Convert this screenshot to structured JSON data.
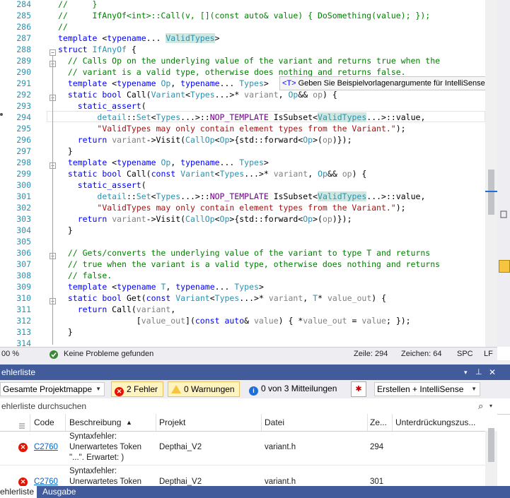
{
  "editor": {
    "lines": [
      {
        "n": "284",
        "html": "<span class=\"cm\">//     }</span>"
      },
      {
        "n": "285",
        "html": "<span class=\"cm\">//     IfAnyOf&lt;int&gt;::Call(v, [](const auto&amp; value) { DoSomething(value); });</span>"
      },
      {
        "n": "286",
        "html": "<span class=\"cm\">//</span>"
      },
      {
        "n": "287",
        "html": "<span class=\"kw\">template</span> &lt;<span class=\"kw\">typename</span>... <span class=\"ty hl\">ValidTypes</span>&gt;"
      },
      {
        "n": "288",
        "html": "<span class=\"kw\">struct</span> <span class=\"ty\">IfAnyOf</span> {"
      },
      {
        "n": "289",
        "html": "  <span class=\"cm\">// Calls Op on the underlying value of the variant and returns true when the</span>"
      },
      {
        "n": "290",
        "html": "  <span class=\"cm\">// variant is a valid type, otherwise does nothing and returns false.</span>"
      },
      {
        "n": "291",
        "html": "  <span class=\"kw\">template</span> &lt;<span class=\"kw\">typename</span> <span class=\"ty\">Op</span>, <span class=\"kw\">typename</span>... <span class=\"ty\">Types</span>&gt;"
      },
      {
        "n": "292",
        "html": "  <span class=\"kw\">static</span> <span class=\"kw\">bool</span> Call(<span class=\"ty\">Variant</span>&lt;<span class=\"ty\">Types</span>...&gt;* <span class=\"pa\">variant</span>, <span class=\"ty\">Op</span>&amp;&amp; <span class=\"pa\">op</span>) {"
      },
      {
        "n": "293",
        "html": "    <span class=\"kw\">static_assert</span>("
      },
      {
        "n": "294",
        "html": "        <span class=\"ty\">detail</span>::<span class=\"ty\">Set</span>&lt;<span class=\"ty\">Types</span>...&gt;::<span class=\"mc\">NOP_TEMPLATE</span> IsSubset&lt;<span class=\"ty hl\">ValidTypes</span>...&gt;::value,"
      },
      {
        "n": "295",
        "html": "        <span class=\"st\">\"ValidTypes may only contain element types from the Variant.\"</span>);"
      },
      {
        "n": "296",
        "html": "    <span class=\"kw\">return</span> <span class=\"pa\">variant</span>-&gt;Visit(<span class=\"ty\">CallOp</span>&lt;<span class=\"ty\">Op</span>&gt;{std::forward&lt;<span class=\"ty\">Op</span>&gt;(<span class=\"pa\">op</span>)});"
      },
      {
        "n": "297",
        "html": "  }"
      },
      {
        "n": "298",
        "html": "  <span class=\"kw\">template</span> &lt;<span class=\"kw\">typename</span> <span class=\"ty\">Op</span>, <span class=\"kw\">typename</span>... <span class=\"ty\">Types</span>&gt;"
      },
      {
        "n": "299",
        "html": "  <span class=\"kw\">static</span> <span class=\"kw\">bool</span> Call(<span class=\"kw\">const</span> <span class=\"ty\">Variant</span>&lt;<span class=\"ty\">Types</span>...&gt;* <span class=\"pa\">variant</span>, <span class=\"ty\">Op</span>&amp;&amp; <span class=\"pa\">op</span>) {"
      },
      {
        "n": "300",
        "html": "    <span class=\"kw\">static_assert</span>("
      },
      {
        "n": "301",
        "html": "        <span class=\"ty\">detail</span>::<span class=\"ty\">Set</span>&lt;<span class=\"ty\">Types</span>...&gt;::<span class=\"mc\">NOP_TEMPLATE</span> IsSubset&lt;<span class=\"ty hl\">ValidTypes</span>...&gt;::value,"
      },
      {
        "n": "302",
        "html": "        <span class=\"st\">\"ValidTypes may only contain element types from the Variant.\"</span>);"
      },
      {
        "n": "303",
        "html": "    <span class=\"kw\">return</span> <span class=\"pa\">variant</span>-&gt;Visit(<span class=\"ty\">CallOp</span>&lt;<span class=\"ty\">Op</span>&gt;{std::forward&lt;<span class=\"ty\">Op</span>&gt;(<span class=\"pa\">op</span>)});"
      },
      {
        "n": "304",
        "html": "  }"
      },
      {
        "n": "305",
        "html": ""
      },
      {
        "n": "306",
        "html": "  <span class=\"cm\">// Gets/converts the underlying value of the variant to type T and returns</span>"
      },
      {
        "n": "307",
        "html": "  <span class=\"cm\">// true when the variant is a valid type, otherwise does nothing and returns</span>"
      },
      {
        "n": "308",
        "html": "  <span class=\"cm\">// false.</span>"
      },
      {
        "n": "309",
        "html": "  <span class=\"kw\">template</span> &lt;<span class=\"kw\">typename</span> <span class=\"ty\">T</span>, <span class=\"kw\">typename</span>... <span class=\"ty\">Types</span>&gt;"
      },
      {
        "n": "310",
        "html": "  <span class=\"kw\">static</span> <span class=\"kw\">bool</span> Get(<span class=\"kw\">const</span> <span class=\"ty\">Variant</span>&lt;<span class=\"ty\">Types</span>...&gt;* <span class=\"pa\">variant</span>, <span class=\"ty\">T</span>* <span class=\"pa\">value_out</span>) {"
      },
      {
        "n": "311",
        "html": "    <span class=\"kw\">return</span> Call(<span class=\"pa\">variant</span>,"
      },
      {
        "n": "312",
        "html": "                [<span class=\"pa\">value_out</span>](<span class=\"kw\">const</span> <span class=\"kw\">auto</span>&amp; <span class=\"pa\">value</span>) { *<span class=\"pa\">value_out</span> = <span class=\"pa\">value</span>; });"
      },
      {
        "n": "313",
        "html": "  }"
      },
      {
        "n": "314",
        "html": ""
      }
    ],
    "tooltip": {
      "tag": "<T>",
      "text": "Geben Sie Beispielvorlagenargumente für IntelliSense"
    }
  },
  "status_bar": {
    "zoom": "00 %",
    "problems": "Keine Probleme gefunden",
    "line": "Zeile: 294",
    "col": "Zeichen: 64",
    "spc": "SPC",
    "lf": "LF"
  },
  "error_list": {
    "title": "ehlerliste",
    "scope": "Gesamte Projektmappe",
    "errors": "2 Fehler",
    "warnings": "0 Warnungen",
    "messages": "0 von 3 Mitteilungen",
    "build_filter": "Erstellen + IntelliSense",
    "search_placeholder": "ehlerliste durchsuchen",
    "columns": {
      "code": "Code",
      "desc": "Beschreibung",
      "project": "Projekt",
      "file": "Datei",
      "line": "Ze...",
      "suppress": "Unterdrückungszus..."
    },
    "rows": [
      {
        "code": "C2760",
        "desc1": "Syntaxfehler:",
        "desc2": "Unerwartetes Token",
        "desc3": "\"...\". Erwartet: )",
        "project": "Depthai_V2",
        "file": "variant.h",
        "line": "294"
      },
      {
        "code": "C2760",
        "desc1": "Syntaxfehler:",
        "desc2": "Unerwartetes Token",
        "desc3": "",
        "project": "Depthai_V2",
        "file": "variant.h",
        "line": "301"
      }
    ]
  },
  "bottom_tabs": {
    "errors": "ehlerliste",
    "output": "Ausgabe"
  },
  "colors": {
    "accent": "#425c9b",
    "error": "#e51400",
    "warning": "#f5c542",
    "info": "#1e6fd9"
  }
}
